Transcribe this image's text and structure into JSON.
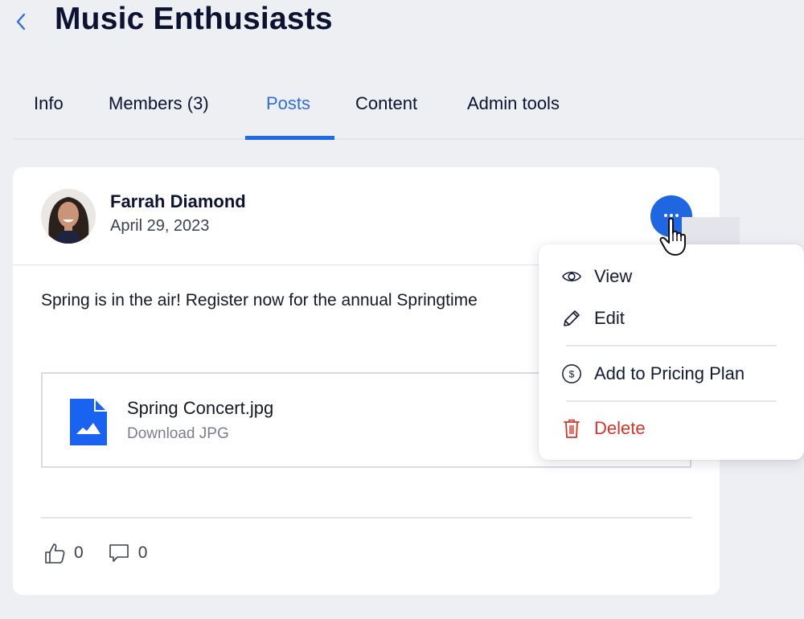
{
  "header": {
    "back_icon": "chevron-left-icon",
    "title": "Music Enthusiasts"
  },
  "tabs": [
    {
      "label": "Info",
      "active": false
    },
    {
      "label": "Members (3)",
      "active": false
    },
    {
      "label": "Posts",
      "active": true
    },
    {
      "label": "Content",
      "active": false
    },
    {
      "label": "Admin tools",
      "active": false
    }
  ],
  "post": {
    "author": "Farrah Diamond",
    "date": "April 29, 2023",
    "text": "Spring is in the air! Register now for the annual Springtime",
    "attachment": {
      "file_name": "Spring Concert.jpg",
      "action": "Download JPG",
      "icon": "image-file-icon"
    },
    "likes": "0",
    "comments": "0",
    "more_icon": "more-horizontal-icon"
  },
  "menu": {
    "items": [
      {
        "label": "View",
        "icon": "eye-icon"
      },
      {
        "label": "Edit",
        "icon": "pencil-icon"
      },
      {
        "label": "Add to Pricing Plan",
        "icon": "dollar-circle-icon"
      },
      {
        "label": "Delete",
        "icon": "trash-icon",
        "danger": true
      }
    ]
  },
  "colors": {
    "accent": "#1f66e0",
    "active_tab": "#2f6fdb",
    "danger": "#d1362b",
    "background": "#eeeff3",
    "text_primary": "#0c1332"
  }
}
